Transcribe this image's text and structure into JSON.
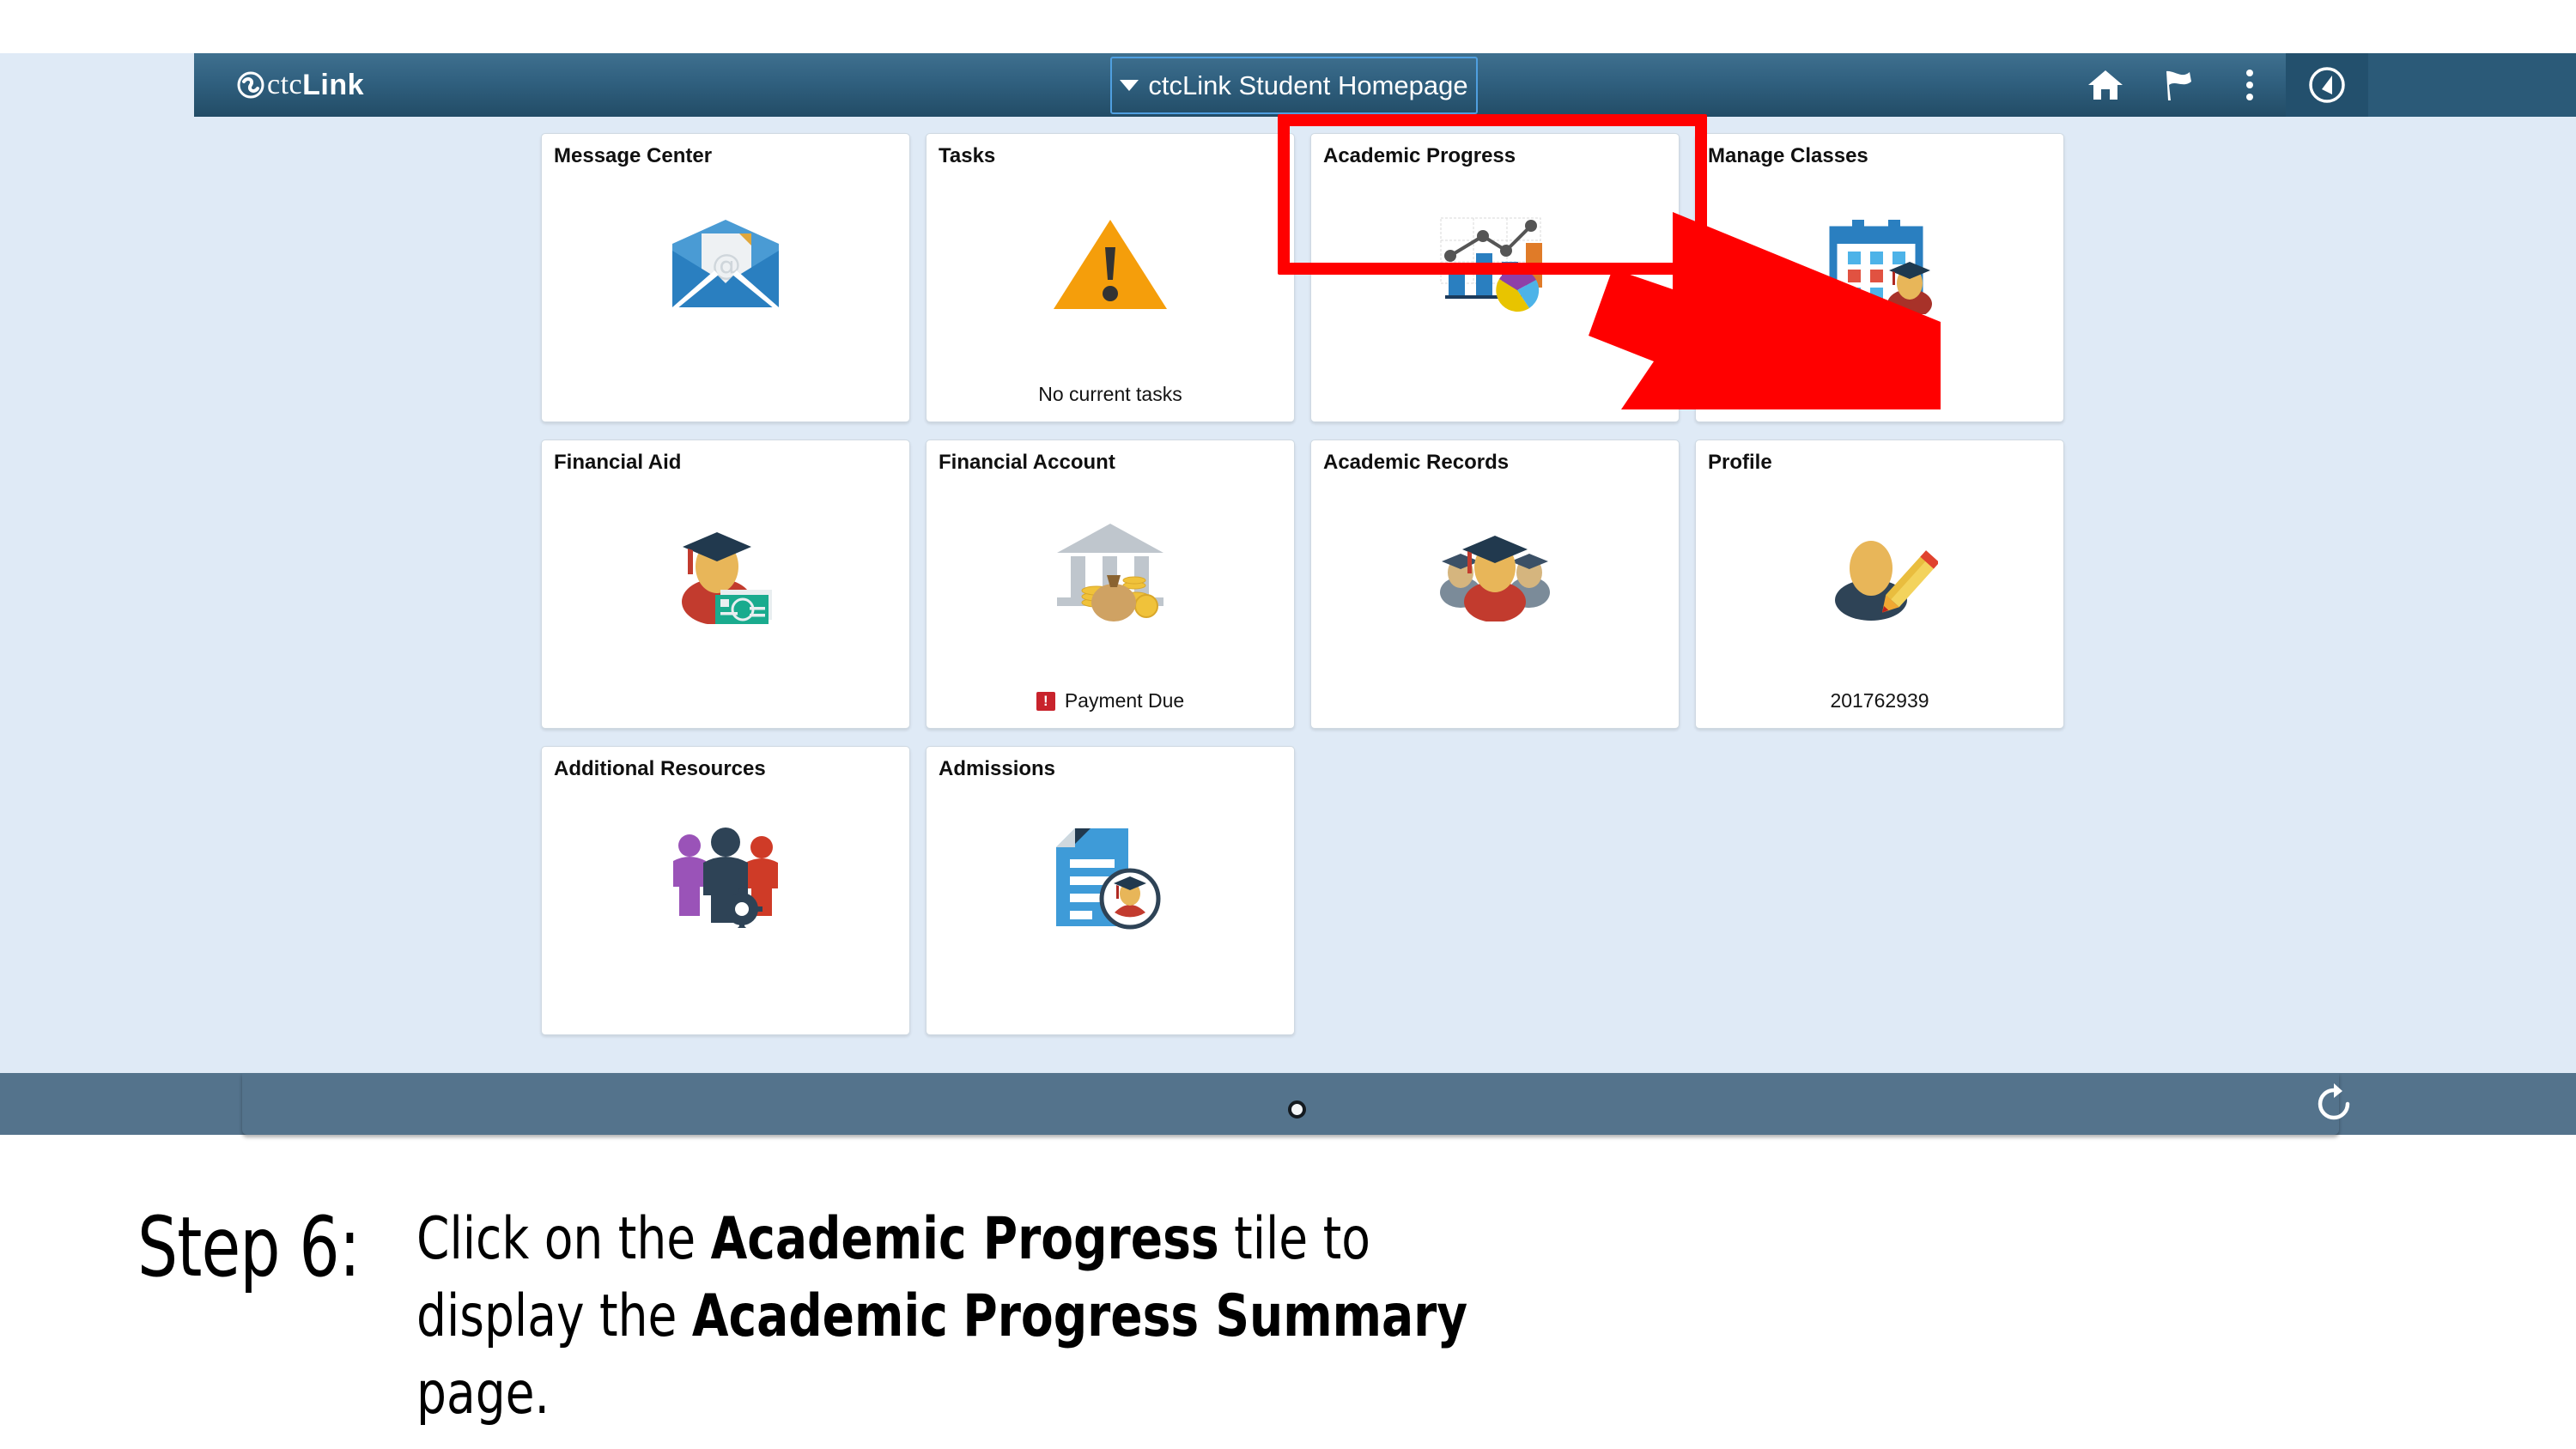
{
  "app": {
    "brand_ctc": "ctc",
    "brand_link": "Link",
    "page_title": "ctcLink Student Homepage",
    "brand_logo_icon": "ctclink-swirl-logo"
  },
  "header_icons": [
    {
      "name": "home-icon",
      "label": "Home"
    },
    {
      "name": "flag-icon",
      "label": "Notifications"
    },
    {
      "name": "kebab-menu-icon",
      "label": "Actions"
    },
    {
      "name": "navbar-compass-icon",
      "label": "NavBar"
    }
  ],
  "tiles": [
    {
      "title": "Message Center",
      "icon": "envelope-email-icon",
      "status": ""
    },
    {
      "title": "Tasks",
      "icon": "warning-triangle-icon",
      "status": "No current tasks"
    },
    {
      "title": "Academic Progress",
      "icon": "bar-line-pie-chart-icon",
      "status": "",
      "highlighted": true
    },
    {
      "title": "Manage Classes",
      "icon": "calendar-graduate-icon",
      "status": ""
    },
    {
      "title": "Financial Aid",
      "icon": "graduate-money-icon",
      "status": ""
    },
    {
      "title": "Financial Account",
      "icon": "bank-moneybag-icon",
      "status": "Payment Due",
      "status_badge": "!"
    },
    {
      "title": "Academic Records",
      "icon": "graduates-group-icon",
      "status": ""
    },
    {
      "title": "Profile",
      "icon": "person-pencil-icon",
      "status": "201762939"
    },
    {
      "title": "Additional Resources",
      "icon": "people-gear-icon",
      "status": ""
    },
    {
      "title": "Admissions",
      "icon": "document-graduate-icon",
      "status": ""
    }
  ],
  "bottom_bar": {
    "page_indicator": "page-dot-1",
    "refresh_icon": "refresh-icon"
  },
  "caption": {
    "step": "Step 6:",
    "line1_pre": "Click on the ",
    "line1_bold": "Academic Progress",
    "line1_mid": " tile to display the ",
    "line1_bold2": "Academic",
    "line2_bold": "Progress Summary",
    "line2_post": " page."
  },
  "colors": {
    "header_blue": "#2b5a78",
    "page_bg": "#dfeaf6",
    "highlight_red": "#ff0000",
    "bottom_bar": "#54738c",
    "alert_red": "#c8232c"
  }
}
